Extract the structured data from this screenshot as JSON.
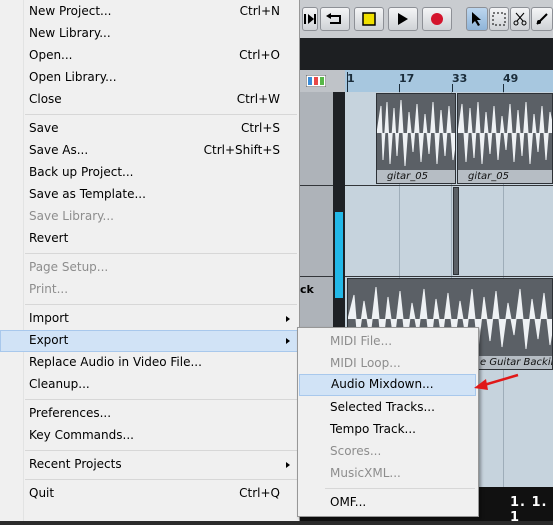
{
  "file_menu": {
    "items": [
      {
        "label": "New Project...",
        "shortcut": "Ctrl+N",
        "enabled": true
      },
      {
        "label": "New Library...",
        "shortcut": "",
        "enabled": true
      },
      {
        "label": "Open...",
        "shortcut": "Ctrl+O",
        "enabled": true
      },
      {
        "label": "Open Library...",
        "shortcut": "",
        "enabled": true
      },
      {
        "label": "Close",
        "shortcut": "Ctrl+W",
        "enabled": true
      },
      {
        "label": "Save",
        "shortcut": "Ctrl+S",
        "enabled": true
      },
      {
        "label": "Save As...",
        "shortcut": "Ctrl+Shift+S",
        "enabled": true
      },
      {
        "label": "Back up Project...",
        "shortcut": "",
        "enabled": true
      },
      {
        "label": "Save as Template...",
        "shortcut": "",
        "enabled": true
      },
      {
        "label": "Save Library...",
        "shortcut": "",
        "enabled": false
      },
      {
        "label": "Revert",
        "shortcut": "",
        "enabled": true
      },
      {
        "label": "Page Setup...",
        "shortcut": "",
        "enabled": false
      },
      {
        "label": "Print...",
        "shortcut": "",
        "enabled": false
      },
      {
        "label": "Import",
        "shortcut": "",
        "enabled": true,
        "submenu": true
      },
      {
        "label": "Export",
        "shortcut": "",
        "enabled": true,
        "submenu": true,
        "highlighted": true
      },
      {
        "label": "Replace Audio in Video File...",
        "shortcut": "",
        "enabled": true
      },
      {
        "label": "Cleanup...",
        "shortcut": "",
        "enabled": true
      },
      {
        "label": "Preferences...",
        "shortcut": "",
        "enabled": true
      },
      {
        "label": "Key Commands...",
        "shortcut": "",
        "enabled": true
      },
      {
        "label": "Recent Projects",
        "shortcut": "",
        "enabled": true,
        "submenu": true
      },
      {
        "label": "Quit",
        "shortcut": "Ctrl+Q",
        "enabled": true
      }
    ]
  },
  "export_submenu": {
    "items": [
      {
        "label": "MIDI File...",
        "enabled": false
      },
      {
        "label": "MIDI Loop...",
        "enabled": false
      },
      {
        "label": "Audio Mixdown...",
        "enabled": true,
        "highlighted": true
      },
      {
        "label": "Selected Tracks...",
        "enabled": true
      },
      {
        "label": "Tempo Track...",
        "enabled": true
      },
      {
        "label": "Scores...",
        "enabled": false
      },
      {
        "label": "MusicXML...",
        "enabled": false
      },
      {
        "label": "OMF...",
        "enabled": true
      }
    ]
  },
  "project_window": {
    "ruler_ticks": [
      "1",
      "17",
      "33",
      "49"
    ],
    "track_name_partial": "ck",
    "clips": [
      {
        "name": "gitar_05"
      },
      {
        "name": "gitar_05"
      },
      {
        "name": "e Guitar Backing"
      }
    ],
    "position_display": "1. 1. 1"
  },
  "colors": {
    "menu_background": "#f0f0f0",
    "menu_highlight": "#d1e3f6",
    "disabled_text": "#8d8d8d",
    "ruler": "#a7c7df",
    "annotation_arrow": "#e01818"
  }
}
